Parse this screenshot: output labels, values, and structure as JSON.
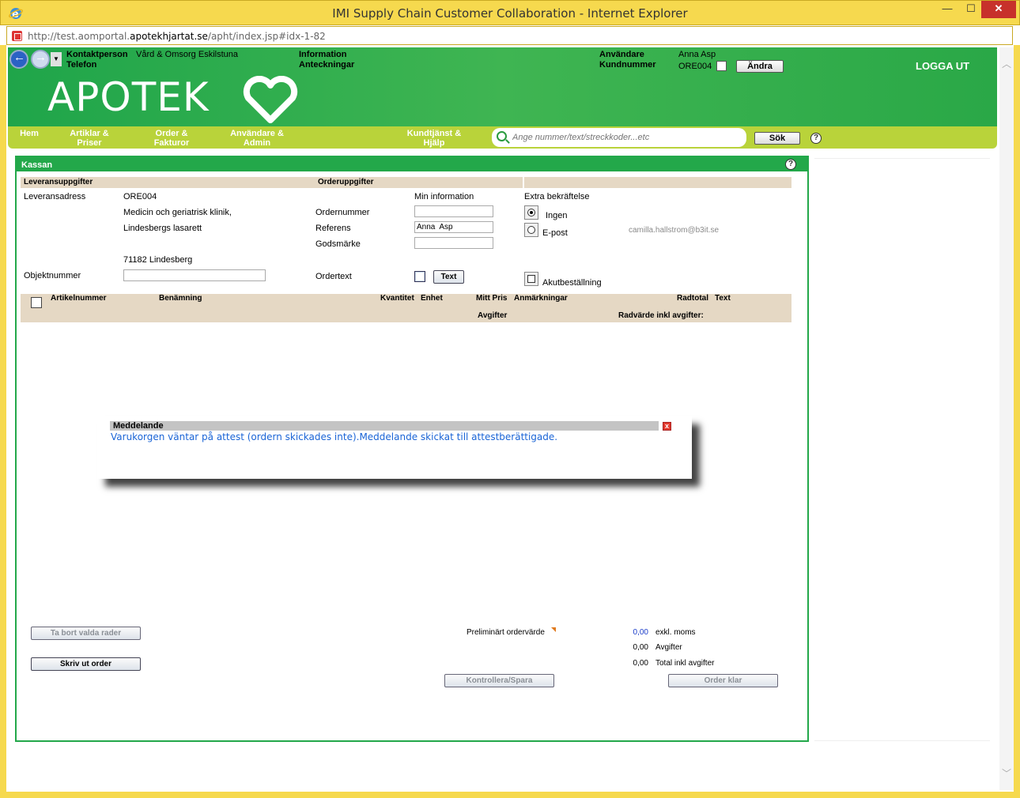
{
  "window": {
    "title": "IMI Supply Chain Customer Collaboration - Internet Explorer",
    "url_prefix": "http://test.aomportal.",
    "url_domain": "apotekhjartat.se",
    "url_path": "/apht/index.jsp#idx-1-82"
  },
  "header": {
    "contact_label": "Kontaktperson",
    "contact_value": "Vård & Omsorg Eskilstuna",
    "phone_label": "Telefon",
    "info_label": "Information",
    "notes_label": "Anteckningar",
    "user_label": "Användare",
    "user_value": "Anna Asp",
    "customer_label": "Kundnummer",
    "customer_value": "ORE004",
    "change_button": "Ändra",
    "logout": "LOGGA UT",
    "logo": "APOTEK"
  },
  "nav": {
    "items": [
      {
        "line1": "Hem",
        "line2": ""
      },
      {
        "line1": "Artiklar &",
        "line2": "Priser"
      },
      {
        "line1": "Order &",
        "line2": "Fakturor"
      },
      {
        "line1": "Användare &",
        "line2": "Admin"
      },
      {
        "line1": "Kundtjänst &",
        "line2": "Hjälp"
      }
    ],
    "search_placeholder": "Ange nummer/text/streckkoder...etc",
    "search_button": "Sök"
  },
  "panel": {
    "title": "Kassan",
    "delivery_header": "Leveransuppgifter",
    "order_header": "Orderuppgifter",
    "delivery_address_label": "Leveransadress",
    "address_lines": [
      "ORE004",
      "Medicin och geriatrisk klinik,",
      "Lindesbergs lasarett",
      "71182 Lindesberg"
    ],
    "object_number_label": "Objektnummer",
    "object_number_value": "",
    "my_info_label": "Min information",
    "order_number_label": "Ordernummer",
    "order_number_value": "",
    "reference_label": "Referens",
    "reference_value": "Anna  Asp",
    "goods_mark_label": "Godsmärke",
    "goods_mark_value": "",
    "order_text_label": "Ordertext",
    "text_button": "Text",
    "extra_confirm_label": "Extra bekräftelse",
    "radio_none": "Ingen",
    "radio_email": "E-post",
    "email_value": "camilla.hallstrom@b3it.se",
    "urgent_label": "Akutbeställning"
  },
  "grid": {
    "columns_row1": [
      "Artikelnummer",
      "Benämning",
      "Kvantitet",
      "Enhet",
      "Mitt Pris",
      "Anmärkningar",
      "Radtotal",
      "Text"
    ],
    "columns_row2": [
      "Avgifter",
      "Radvärde inkl avgifter:"
    ]
  },
  "dialog": {
    "title": "Meddelande",
    "message": "Varukorgen väntar på attest (ordern skickades inte).Meddelande skickat till attestberättigade."
  },
  "footer": {
    "remove_button": "Ta bort valda rader",
    "print_button": "Skriv ut order",
    "check_save_button": "Kontrollera/Spara",
    "order_done_button": "Order klar",
    "preliminary_label": "Preliminärt ordervärde",
    "excl_vat_value": "0,00",
    "excl_vat_label": "exkl. moms",
    "fees_value": "0,00",
    "fees_label": "Avgifter",
    "total_value": "0,00",
    "total_label": "Total inkl avgifter"
  },
  "colors": {
    "brand_green": "#23a84a",
    "nav_lime": "#b9d33a",
    "window_frame": "#f6d94e",
    "header_band": "#e5d8c4",
    "message_blue": "#1a64d6"
  }
}
